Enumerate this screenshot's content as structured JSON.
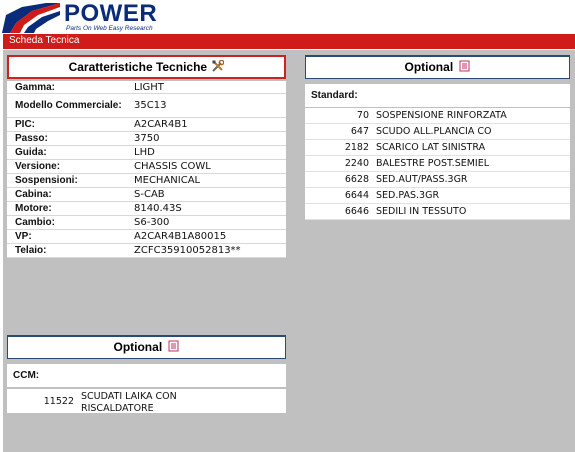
{
  "brand": {
    "name": "POWER",
    "tagline": "Parts On Web Easy Research"
  },
  "nav": {
    "title": "Scheda Tecnica"
  },
  "specs_panel": {
    "title": "Caratteristiche Tecniche",
    "icon": "tools-icon",
    "rows": [
      {
        "label": "Gamma:",
        "value": "LIGHT"
      },
      {
        "label": "Modello Commerciale:",
        "value": "35C13"
      },
      {
        "label": "PIC:",
        "value": "A2CAR4B1"
      },
      {
        "label": "Passo:",
        "value": "3750"
      },
      {
        "label": "Guida:",
        "value": "LHD"
      },
      {
        "label": "Versione:",
        "value": "CHASSIS COWL"
      },
      {
        "label": "Sospensioni:",
        "value": "MECHANICAL"
      },
      {
        "label": "Cabina:",
        "value": "S-CAB"
      },
      {
        "label": "Motore:",
        "value": "8140.43S"
      },
      {
        "label": "Cambio:",
        "value": "S6-300"
      },
      {
        "label": "VP:",
        "value": "A2CAR4B1A80015"
      },
      {
        "label": "Telaio:",
        "value": "ZCFC35910052813**"
      }
    ]
  },
  "optional_standard": {
    "title": "Optional",
    "icon": "document-icon",
    "section_label": "Standard:",
    "items": [
      {
        "code": "70",
        "desc": "SOSPENSIONE RINFORZATA"
      },
      {
        "code": "647",
        "desc": "SCUDO ALL.PLANCIA CO"
      },
      {
        "code": "2182",
        "desc": "SCARICO LAT SINISTRA"
      },
      {
        "code": "2240",
        "desc": "BALESTRE POST.SEMIEL"
      },
      {
        "code": "6628",
        "desc": "SED.AUT/PASS.3GR"
      },
      {
        "code": "6644",
        "desc": "SED.PAS.3GR"
      },
      {
        "code": "6646",
        "desc": "SEDILI IN TESSUTO"
      }
    ]
  },
  "optional_ccm": {
    "title": "Optional",
    "icon": "document-icon",
    "section_label": "CCM:",
    "items": [
      {
        "code": "11522",
        "desc": "SCUDATI LAIKA CON RISCALDATORE"
      }
    ]
  },
  "colors": {
    "accent_red": "#d01b1b",
    "brand_blue": "#0a2a7a",
    "background_gray": "#c0c0c0"
  }
}
